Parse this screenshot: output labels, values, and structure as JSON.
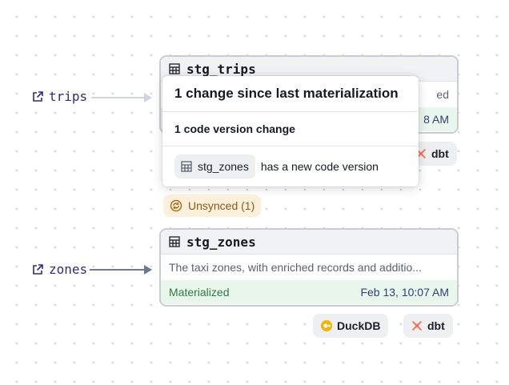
{
  "assets": [
    {
      "name": "trips",
      "node_title": "stg_trips",
      "description_fragment": "ed",
      "time_fragment": "8 AM"
    },
    {
      "name": "zones",
      "node_title": "stg_zones",
      "description": "The taxi zones, with enriched records and additio...",
      "status": "Materialized",
      "time": "Feb 13, 10:07 AM"
    }
  ],
  "popover": {
    "title": "1 change since last materialization",
    "subtitle": "1 code version change",
    "change_asset": "stg_zones",
    "change_text": "has a new code version"
  },
  "unsynced_label": "Unsynced (1)",
  "tags": {
    "duckdb": "DuckDB",
    "dbt": "dbt"
  },
  "colors": {
    "link": "#2e2a86",
    "edge_active": "#6e7890",
    "edge_muted": "#d0d4dc",
    "materialized_bg": "#e8f6ec",
    "unsynced_bg": "#fbf0dc",
    "duckdb": "#f5b400",
    "dbt": "#ff694a"
  }
}
